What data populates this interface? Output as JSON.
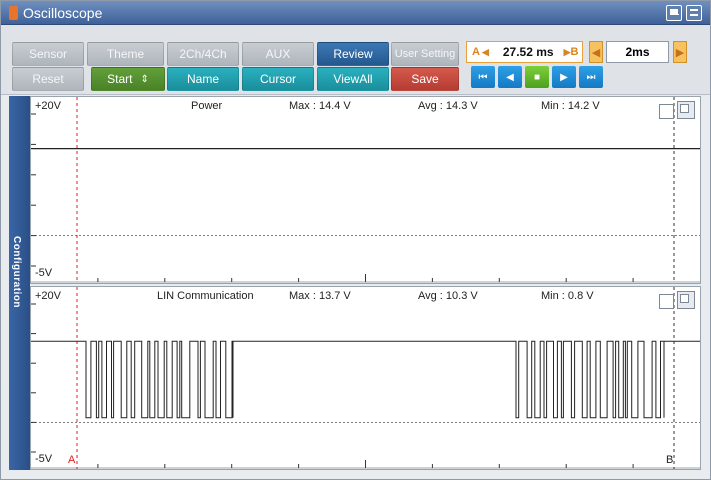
{
  "app": {
    "title": "Oscilloscope"
  },
  "toolbar": {
    "row1": [
      {
        "label": "Sensor",
        "style": "gray"
      },
      {
        "label": "Theme",
        "style": "gray"
      },
      {
        "label": "2Ch/4Ch",
        "style": "gray"
      },
      {
        "label": "AUX",
        "style": "gray"
      },
      {
        "label": "Review",
        "style": "blue"
      },
      {
        "label": "User Setting",
        "style": "gray"
      }
    ],
    "row2": [
      {
        "label": "Reset",
        "style": "gray"
      },
      {
        "label": "Start",
        "style": "green"
      },
      {
        "label": "Name",
        "style": "teal"
      },
      {
        "label": "Cursor",
        "style": "teal"
      },
      {
        "label": "ViewAll",
        "style": "teal"
      },
      {
        "label": "Save",
        "style": "red"
      }
    ],
    "cursor_time": {
      "a_label": "A",
      "b_label": "B",
      "value": "27.52 ms"
    },
    "time_scale": "2ms"
  },
  "side_panel": {
    "label": "Configuration"
  },
  "channels": [
    {
      "name": "Power",
      "top_scale": "+20V",
      "bottom_scale": "-5V",
      "max": "Max : 14.4 V",
      "avg": "Avg : 14.3 V",
      "min": "Min : 14.2 V",
      "signal_level_v": 14.3
    },
    {
      "name": "LIN Communication",
      "top_scale": "+20V",
      "bottom_scale": "-5V",
      "max": "Max : 13.7 V",
      "avg": "Avg : 10.3 V",
      "min": "Min : 0.8 V",
      "signal_high_v": 13.7,
      "signal_low_v": 0.8
    }
  ],
  "cursors": {
    "a": "A",
    "b": "B"
  },
  "colors": {
    "accent_blue": "#2a4f86",
    "cursor_a": "#e02020",
    "time_accent": "#e8a13a"
  }
}
